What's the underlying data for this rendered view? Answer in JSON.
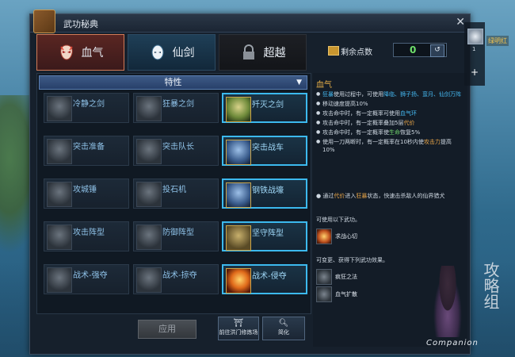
{
  "window": {
    "title": "武功秘典"
  },
  "tabs": [
    {
      "label": "血气",
      "icon": "demon-mask-icon",
      "active": true
    },
    {
      "label": "仙剑",
      "icon": "spirit-mask-icon",
      "active": false
    },
    {
      "label": "超越",
      "icon": "lock-icon",
      "active": false
    }
  ],
  "points": {
    "label": "剩余点数",
    "value": "0"
  },
  "dropdown": {
    "label": "特性"
  },
  "skills": [
    [
      {
        "name": "冷静之剑",
        "active": false
      },
      {
        "name": "狂暴之剑",
        "active": false
      },
      {
        "name": "歼灭之剑",
        "active": true
      }
    ],
    [
      {
        "name": "突击准备",
        "active": false
      },
      {
        "name": "突击队长",
        "active": false
      },
      {
        "name": "突击战车",
        "active": true
      }
    ],
    [
      {
        "name": "攻城锤",
        "active": false
      },
      {
        "name": "投石机",
        "active": false
      },
      {
        "name": "钢铁战壕",
        "active": true
      }
    ],
    [
      {
        "name": "攻击阵型",
        "active": false
      },
      {
        "name": "防御阵型",
        "active": false
      },
      {
        "name": "坚守阵型",
        "active": true
      }
    ],
    [
      {
        "name": "战术-强夺",
        "active": false
      },
      {
        "name": "战术-掠夺",
        "active": false
      },
      {
        "name": "战术-侵夺",
        "active": true
      }
    ]
  ],
  "buttons": {
    "apply": "应用",
    "train": "前往洪门修炼场",
    "simplify": "简化"
  },
  "detail": {
    "title": "血气",
    "b1_a": "狂暴",
    "b1_b": "使用过程中，可使用",
    "b1_c": "降临、狮子扬、蛮月、仙剑万阵",
    "b2": "移动速度提高10%",
    "b3_a": "攻击命中时，有一定概率可使用",
    "b3_b": "血气环",
    "b4_a": "攻击命中时，有一定概率叠加5层",
    "b4_b": "代价",
    "b5_a": "攻击命中时，有一定概率使",
    "b5_b": "生命",
    "b5_c": "恢复5%",
    "b6_a": "使用一刀两断时，有一定概率在10秒内使",
    "b6_b": "攻击力",
    "b6_c": "提高10%",
    "note_a": "通过",
    "note_b": "代价",
    "note_c": "进入",
    "note_d": "狂暴",
    "note_e": "状态，快速击杀敌人的仙界猎犬",
    "usable_label": "可使用以下武功。",
    "usable_skill": "求战心切",
    "changed_label": "可变更、获得下列武功效果。",
    "effects": [
      "疯狂之法",
      "血气扩散"
    ]
  },
  "side": {
    "count": "1",
    "plus": "+",
    "name": "绿明红"
  },
  "companion": {
    "label": "Companion",
    "glyphs": "攻略组"
  },
  "colors": {
    "accent_blue": "#3cb9ee",
    "accent_orange": "#e8a548",
    "points_green": "#6ee06b"
  }
}
